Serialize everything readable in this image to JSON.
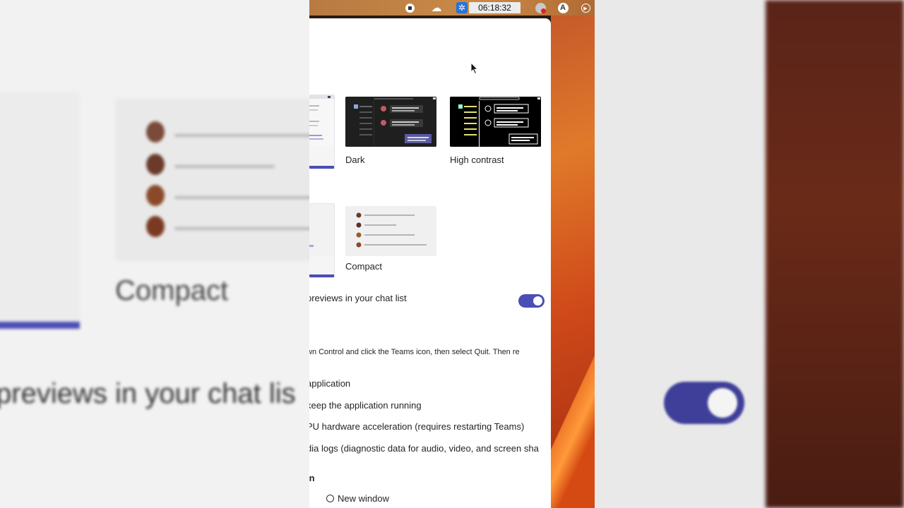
{
  "menubar": {
    "clock": "06:18:32",
    "icons": [
      "stop-icon",
      "cloud-icon",
      "gear-icon",
      "clock-display",
      "recording-icon",
      "app-a-icon",
      "play-icon"
    ]
  },
  "background": {
    "compact_label": "Compact",
    "previews_text": "previews in your chat lis"
  },
  "settings": {
    "themes": [
      {
        "label": "Dark"
      },
      {
        "label": "High contrast"
      }
    ],
    "layouts": [
      {
        "label": "Compact"
      }
    ],
    "chat_previews": {
      "label": "previews in your chat list",
      "enabled": true
    },
    "quit_note": "wn Control and click the Teams icon, then select Quit. Then re",
    "app_options": [
      "application",
      "keep the application running",
      "PU hardware acceleration (requires restarting Teams)",
      "dia logs (diagnostic data for audio, video, and screen sha"
    ],
    "open_in": {
      "heading": "in",
      "option": "New window"
    }
  },
  "colors": {
    "accent": "#4b4eb5",
    "panel_bg": "#ffffff",
    "highlight_yellow": "#e6e06a"
  }
}
